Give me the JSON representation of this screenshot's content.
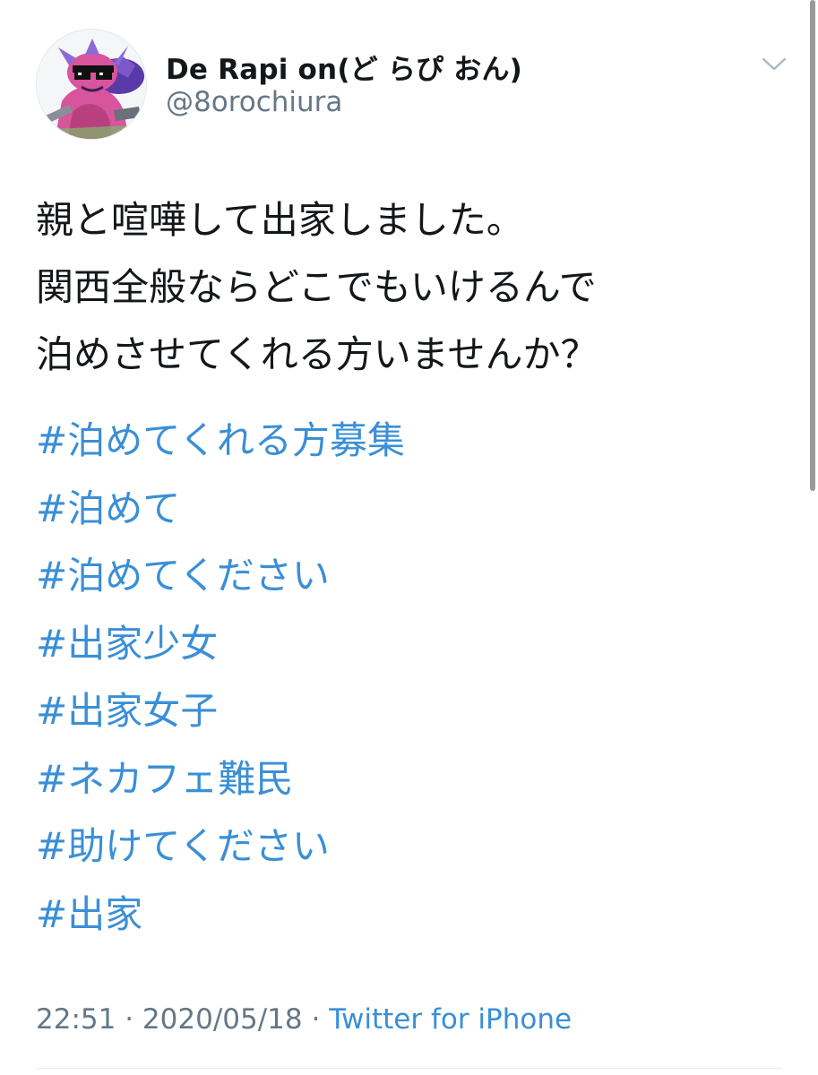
{
  "user": {
    "display_name": "De Rapi on(ど らぴ おん)",
    "handle": "@8orochiura"
  },
  "header": {
    "menu_icon": "chevron-down-icon"
  },
  "tweet": {
    "lines": [
      "親と喧嘩して出家しました。",
      "関西全般ならどこでもいけるんで",
      "泊めさせてくれる方いませんか？"
    ],
    "hashtags": [
      "#泊めてくれる方募集",
      "#泊めて",
      "#泊めてください",
      "#出家少女",
      "#出家女子",
      "#ネカフェ難民",
      "#助けてください",
      "#出家"
    ],
    "time": "22:51",
    "separator": "·",
    "date": "2020/05/18",
    "source": "Twitter for iPhone"
  },
  "colors": {
    "text": "#14171a",
    "secondary": "#657786",
    "link": "#3a8fd6"
  }
}
